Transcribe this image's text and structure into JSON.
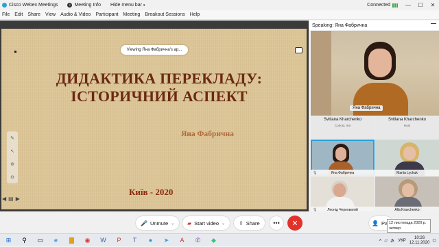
{
  "titlebar": {
    "app_name": "Cisco Webex Meetings",
    "meeting_info": "Meeting Info",
    "hide_menu_bar": "Hide menu bar",
    "status": "Connected",
    "minimize": "—",
    "maximize": "☐",
    "close": "✕"
  },
  "menu": [
    "File",
    "Edit",
    "Share",
    "View",
    "Audio & Video",
    "Participant",
    "Meeting",
    "Breakout Sessions",
    "Help"
  ],
  "share": {
    "viewing_label": "Viewing Яна Фабрична's ap...",
    "slide": {
      "title_line1": "ДИДАКТИКА ПЕРЕКЛАДУ:",
      "title_line2": "ІСТОРИЧНИЙ АСПЕКТ",
      "author": "Яна Фабрична",
      "city_year": "Київ - 2020"
    }
  },
  "panel": {
    "speaking": "Speaking: Яна Фабрична",
    "active_speaker_name": "Яна Фабрична",
    "participants": [
      {
        "name": "Svitlana Kharchenko",
        "role": "Cohost, me"
      },
      {
        "name": "Svitlana Kharchenko",
        "role": "Host"
      },
      {
        "name": "Яна Фабрична"
      },
      {
        "name": "Mariia Lychuk"
      },
      {
        "name": "Леонід Черноватий"
      },
      {
        "name": "Alla Kravchenko"
      }
    ]
  },
  "toolbar": {
    "unmute": "Unmute",
    "start_video": "Start video",
    "share": "Share",
    "more": "•••",
    "end": "✕",
    "participants_partial": "Par"
  },
  "tooltip": {
    "line1": "12 листопада 2020 р.",
    "line2": "четвер"
  },
  "taskbar": {
    "language": "УКР",
    "time": "10:26",
    "date": "12.11.2020"
  },
  "colors": {
    "accent": "#28a0d8",
    "end_call": "#e1322b",
    "slide_title": "#6b2a12",
    "slide_bg": "#dcc597"
  }
}
